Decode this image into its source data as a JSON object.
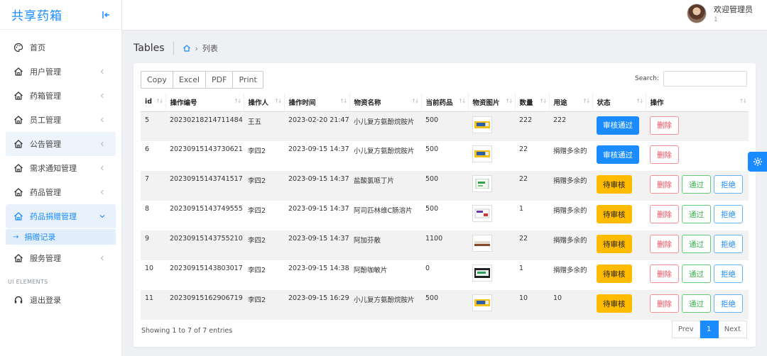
{
  "sidebar": {
    "brand": "共享药箱",
    "items": [
      {
        "label": "首页",
        "icon": "palette-icon",
        "chevron": false
      },
      {
        "label": "用户管理",
        "icon": "home-icon",
        "chevron": true
      },
      {
        "label": "药箱管理",
        "icon": "home-icon",
        "chevron": true
      },
      {
        "label": "员工管理",
        "icon": "home-icon",
        "chevron": true
      },
      {
        "label": "公告管理",
        "icon": "home-icon",
        "chevron": true
      },
      {
        "label": "需求通知管理",
        "icon": "home-icon",
        "chevron": true
      },
      {
        "label": "药品管理",
        "icon": "home-icon",
        "chevron": true
      },
      {
        "label": "药品捐赠管理",
        "icon": "home-icon",
        "chevron": true
      }
    ],
    "submenu": {
      "label": "捐赠记录"
    },
    "service": {
      "label": "服务管理"
    },
    "section_label": "UI ELEMENTS",
    "logout": {
      "label": "退出登录"
    }
  },
  "header": {
    "welcome": "欢迎管理员",
    "uid": "1"
  },
  "breadcrumb": {
    "title": "Tables",
    "current": "列表"
  },
  "toolbar": {
    "buttons": [
      "Copy",
      "Excel",
      "PDF",
      "Print"
    ],
    "search_label": "Search:"
  },
  "table": {
    "columns": [
      "id",
      "操作编号",
      "操作人",
      "操作时间",
      "物资名称",
      "当前药品",
      "物资图片",
      "数量",
      "用途",
      "状态",
      "操作"
    ],
    "rows": [
      {
        "id": "5",
        "code": "20230218214711484",
        "user": "王五",
        "time": "2023-02-20 21:47",
        "name": "小儿复方氨酚烷胺片",
        "stock": "500",
        "img": "yellow",
        "qty": "222",
        "use": "222",
        "status": "审核通过",
        "approved": true
      },
      {
        "id": "6",
        "code": "20230915143730621",
        "user": "李四2",
        "time": "2023-09-15 14:37",
        "name": "小儿复方氨酚烷胺片",
        "stock": "500",
        "img": "yellow",
        "qty": "22",
        "use": "捐赠多余的",
        "status": "审核通过",
        "approved": true
      },
      {
        "id": "7",
        "code": "20230915143741517",
        "user": "李四2",
        "time": "2023-09-15 14:37",
        "name": "盐酸氯哌丁片",
        "stock": "500",
        "img": "green",
        "qty": "22",
        "use": "捐赠多余的",
        "status": "待审核",
        "approved": false
      },
      {
        "id": "8",
        "code": "20230915143749555",
        "user": "李四2",
        "time": "2023-09-15 14:37",
        "name": "阿司匹林维C肠溶片",
        "stock": "500",
        "img": "purple",
        "qty": "1",
        "use": "捐赠多余的",
        "status": "待审核",
        "approved": false
      },
      {
        "id": "9",
        "code": "20230915143755210",
        "user": "李四2",
        "time": "2023-09-15 14:37",
        "name": "阿加芬散",
        "stock": "1100",
        "img": "brown",
        "qty": "22",
        "use": "捐赠多余的",
        "status": "待审核",
        "approved": false
      },
      {
        "id": "10",
        "code": "20230915143803017",
        "user": "李四2",
        "time": "2023-09-15 14:38",
        "name": "阿酚咖敏片",
        "stock": "0",
        "img": "dark",
        "qty": "1",
        "use": "捐赠多余的",
        "status": "待审核",
        "approved": false
      },
      {
        "id": "11",
        "code": "20230915162906719",
        "user": "李四2",
        "time": "2023-09-15 16:29",
        "name": "小儿复方氨酚烷胺片",
        "stock": "500",
        "img": "yellow",
        "qty": "10",
        "use": "10",
        "status": "待审核",
        "approved": false
      }
    ],
    "actions": {
      "delete": "删除",
      "pass": "通过",
      "reject": "拒绝"
    }
  },
  "footer": {
    "info": "Showing 1 to 7 of 7 entries",
    "prev": "Prev",
    "page": "1",
    "next": "Next"
  },
  "colors": {
    "accent": "#1a8cff",
    "pending": "#ffbb00",
    "danger": "#f0505e",
    "success": "#3cb04f"
  }
}
